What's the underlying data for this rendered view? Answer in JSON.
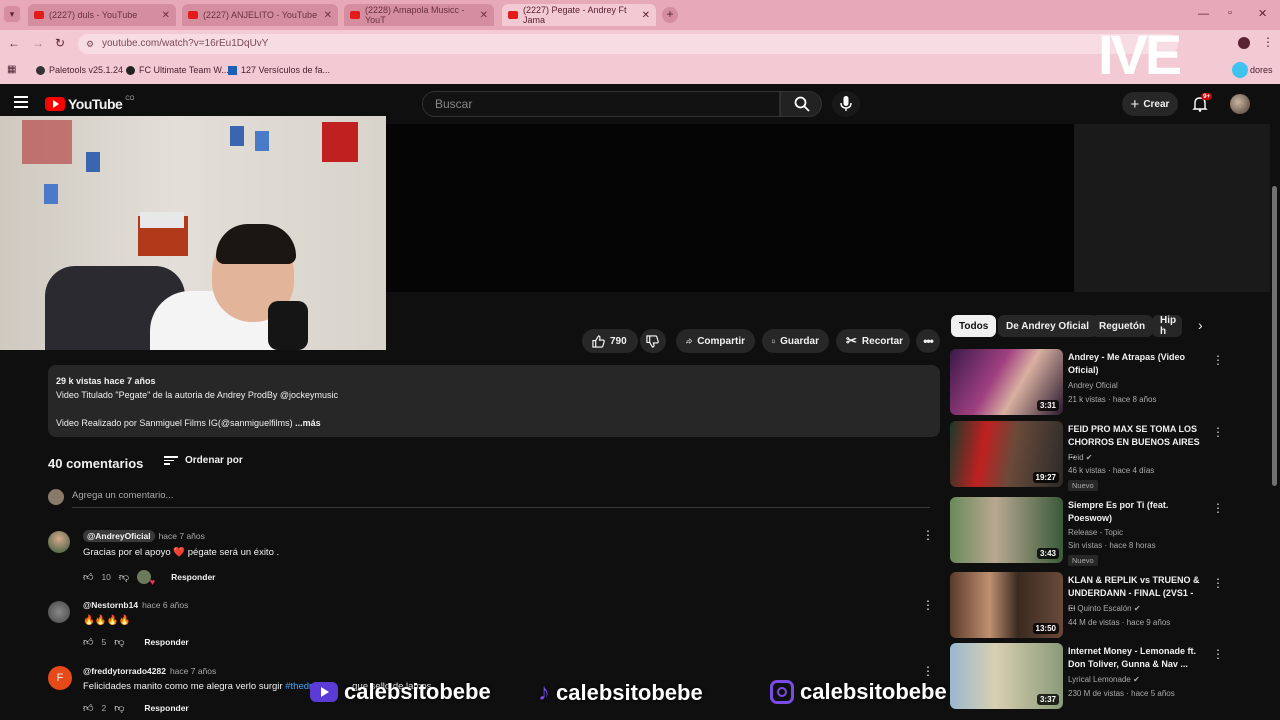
{
  "browser": {
    "tabs": [
      {
        "label": "(2227) duls - YouTube"
      },
      {
        "label": "(2227) ANJELITO - YouTube"
      },
      {
        "label": "(2228) Amapola Musicc - YouT"
      },
      {
        "label": "(2227) Pegate - Andrey Ft Jama"
      }
    ],
    "url": "youtube.com/watch?v=16rEu1DqUvY",
    "bookmarks": [
      {
        "label": "Paletools v25.1.24"
      },
      {
        "label": "FC Ultimate Team W..."
      },
      {
        "label": "127 Versículos de fa..."
      }
    ],
    "bookmarks_right": "dores",
    "accent": "#e7a9b8"
  },
  "youtube": {
    "logo": "YouTube",
    "logo_region": "CO",
    "search_placeholder": "Buscar",
    "create_label": "Crear",
    "notifications_badge": "9+"
  },
  "actions": {
    "likes": "790",
    "share": "Compartir",
    "save": "Guardar",
    "clip": "Recortar"
  },
  "description": {
    "stats": "29 k vistas  hace 7 años",
    "line1": "Video Titulado \"Pegate\" de la autoria de Andrey ProdBy @jockeymusic",
    "line2": "Video Realizado por Sanmiguel Films IG(@sanmiguelfilms)",
    "more": "...más"
  },
  "comments_section": {
    "count_label": "40 comentarios",
    "sort_label": "Ordenar por",
    "add_placeholder": "Agrega un comentario...",
    "reply_label": "Responder",
    "items": [
      {
        "author": "@AndreyOficial",
        "time": "hace 7 años",
        "text": "Gracias por el apoyo ❤️ pégate será un éxito .",
        "likes": "10"
      },
      {
        "author": "@Nestornb14",
        "time": "hace 6 años",
        "text": "🔥🔥🔥🔥",
        "likes": "5"
      },
      {
        "author": "@freddytorrado4282",
        "time": "hace 7 años",
        "text": "Felicidades manito como me alegra verlo surgir ",
        "hashtag": "#thedr",
        "text_tail": "que sello de lamos",
        "likes": "2",
        "avatar_letter": "F"
      }
    ]
  },
  "chips": [
    "Todos",
    "De Andrey Oficial",
    "Reguetón",
    "Hip h"
  ],
  "recommendations": [
    {
      "title": "Andrey - Me Atrapas (Video Oficial)",
      "channel": "Andrey Oficial",
      "meta": "21 k vistas · hace 8 años",
      "duration": "3:31",
      "new": ""
    },
    {
      "title": "FEID PRO MAX SE TOMA LOS CHORROS EN BUENOS AIRES ...",
      "channel": "Feid",
      "meta": "46 k vistas · hace 4 días",
      "duration": "19:27",
      "new": "Nuevo"
    },
    {
      "title": "Siempre Es por Ti (feat. Poeswow)",
      "channel": "Release - Topic",
      "meta": "Sin vistas · hace 8 horas",
      "duration": "3:43",
      "new": "Nuevo"
    },
    {
      "title": "KLAN & REPLIK vs TRUENO & UNDERDANN - FINAL (2VS1 - ...",
      "channel": "El Quinto Escalón",
      "meta": "44 M de vistas · hace 9 años",
      "duration": "13:50",
      "new": ""
    },
    {
      "title": "Internet Money - Lemonade ft. Don Toliver, Gunna & Nav ...",
      "channel": "Lyrical Lemonade",
      "meta": "230 M de vistas · hace 5 años",
      "duration": "3:37",
      "new": ""
    }
  ],
  "overlay": {
    "handles": [
      "calebsitobebe",
      "calebsitobebe",
      "calebsitobebe"
    ],
    "corner_text": "IVE"
  }
}
